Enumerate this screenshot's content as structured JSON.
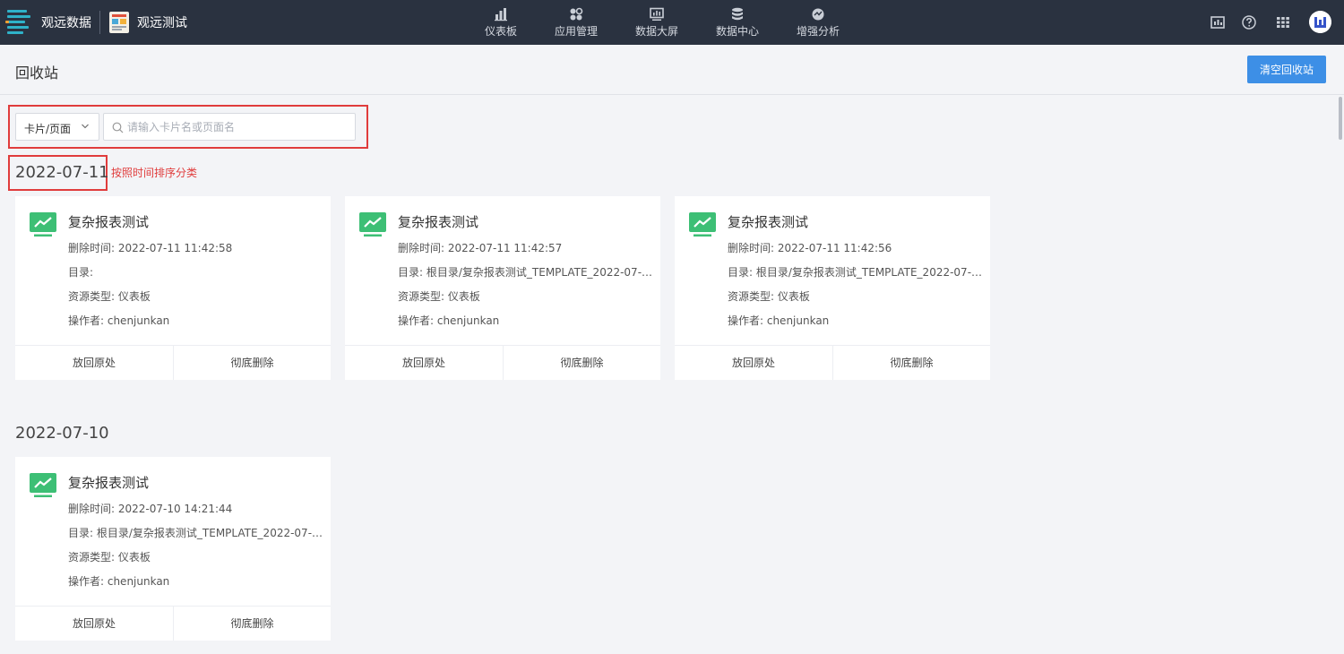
{
  "topbar": {
    "brand": "观远数据",
    "app_name": "观远测试",
    "nav": [
      {
        "label": "仪表板",
        "icon": "bar-chart-icon"
      },
      {
        "label": "应用管理",
        "icon": "apps-grid-icon"
      },
      {
        "label": "数据大屏",
        "icon": "monitor-icon"
      },
      {
        "label": "数据中心",
        "icon": "database-icon"
      },
      {
        "label": "增强分析",
        "icon": "analysis-icon"
      }
    ],
    "right_icons": [
      "dashboard-icon",
      "help-icon",
      "grid-menu-icon",
      "user-avatar"
    ]
  },
  "page": {
    "title": "回收站",
    "clear_button": "清空回收站"
  },
  "filter": {
    "type_value": "卡片/页面",
    "search_placeholder": "请输入卡片名或页面名"
  },
  "annotation": {
    "note": "按照时间排序分类",
    "color": "#e03c3c"
  },
  "groups": [
    {
      "date": "2022-07-11",
      "cards": [
        {
          "title": "复杂报表测试",
          "deleted_at": "删除时间: 2022-07-11 11:42:58",
          "directory": "目录:",
          "resource_type": "资源类型: 仪表板",
          "operator": "操作者: chenjunkan",
          "restore": "放回原处",
          "delete": "彻底删除"
        },
        {
          "title": "复杂报表测试",
          "deleted_at": "删除时间: 2022-07-11 11:42:57",
          "directory": "目录: 根目录/复杂报表测试_TEMPLATE_2022-07-1...",
          "resource_type": "资源类型: 仪表板",
          "operator": "操作者: chenjunkan",
          "restore": "放回原处",
          "delete": "彻底删除"
        },
        {
          "title": "复杂报表测试",
          "deleted_at": "删除时间: 2022-07-11 11:42:56",
          "directory": "目录: 根目录/复杂报表测试_TEMPLATE_2022-07-1...",
          "resource_type": "资源类型: 仪表板",
          "operator": "操作者: chenjunkan",
          "restore": "放回原处",
          "delete": "彻底删除"
        }
      ]
    },
    {
      "date": "2022-07-10",
      "cards": [
        {
          "title": "复杂报表测试",
          "deleted_at": "删除时间: 2022-07-10 14:21:44",
          "directory": "目录: 根目录/复杂报表测试_TEMPLATE_2022-07-1...",
          "resource_type": "资源类型: 仪表板",
          "operator": "操作者: chenjunkan",
          "restore": "放回原处",
          "delete": "彻底删除"
        }
      ]
    }
  ],
  "colors": {
    "topbar": "#2a3240",
    "accent": "#3d8fe6",
    "card_icon": "#3dbf75",
    "brand_logo": "#2fb2c9"
  }
}
